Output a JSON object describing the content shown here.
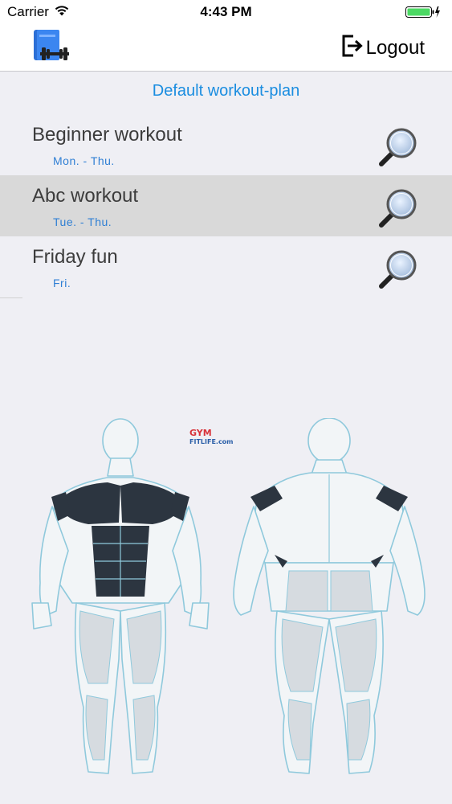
{
  "status_bar": {
    "carrier": "Carrier",
    "time": "4:43 PM",
    "battery_color": "#4cd964"
  },
  "nav_bar": {
    "logo_icon": "workout-book-icon",
    "logout_label": "Logout",
    "logout_icon": "logout-icon"
  },
  "plan": {
    "title": "Default workout-plan",
    "accent_color": "#1a8de0"
  },
  "workouts": [
    {
      "name": "Beginner workout",
      "days": "Mon. -  Thu.",
      "selected": false
    },
    {
      "name": "Abc workout",
      "days": "Tue. -  Thu.",
      "selected": true
    },
    {
      "name": "Friday fun",
      "days": "Fri.",
      "selected": false
    }
  ],
  "illustration": {
    "logo_top": "GYM",
    "logo_bottom": "FITLIFE.com"
  }
}
